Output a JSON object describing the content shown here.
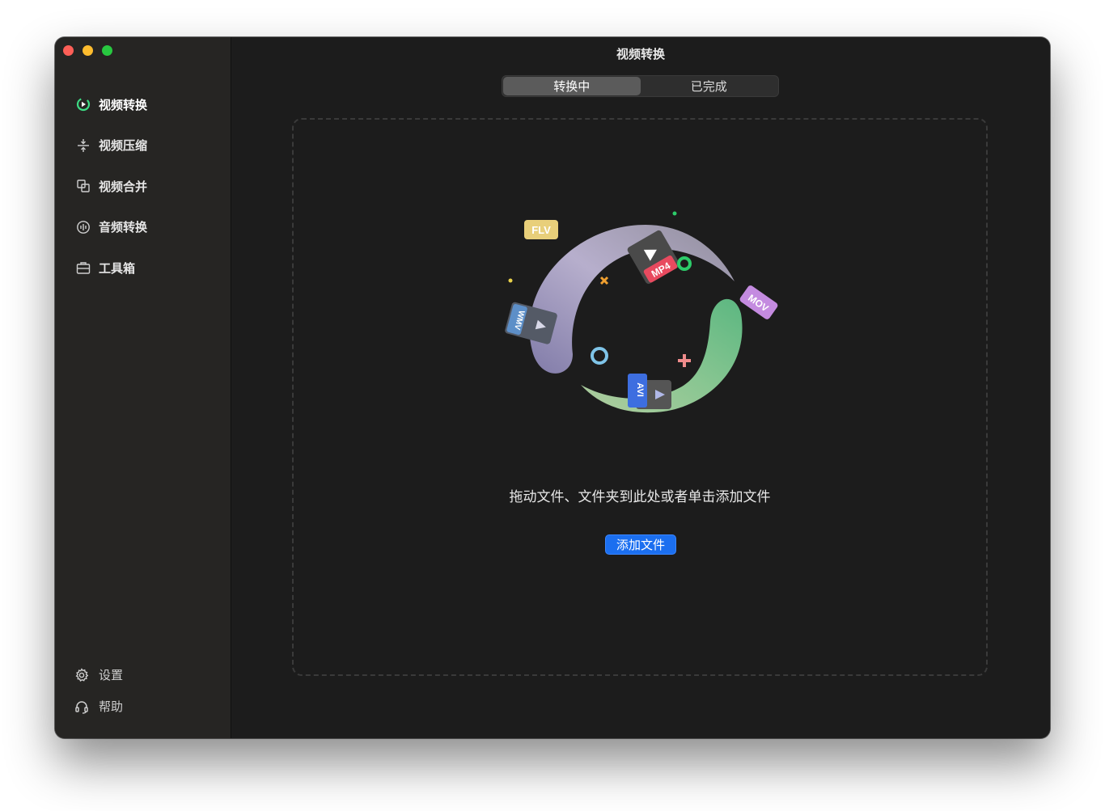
{
  "window": {
    "title": "视频转换"
  },
  "sidebar": {
    "items": [
      {
        "label": "视频转换",
        "icon": "convert-icon",
        "active": true
      },
      {
        "label": "视频压缩",
        "icon": "compress-icon",
        "active": false
      },
      {
        "label": "视频合并",
        "icon": "merge-icon",
        "active": false
      },
      {
        "label": "音频转换",
        "icon": "audio-icon",
        "active": false
      },
      {
        "label": "工具箱",
        "icon": "toolbox-icon",
        "active": false
      }
    ],
    "bottom": [
      {
        "label": "设置",
        "icon": "gear-icon"
      },
      {
        "label": "帮助",
        "icon": "headset-icon"
      }
    ]
  },
  "tabs": [
    {
      "label": "转换中",
      "active": true
    },
    {
      "label": "已完成",
      "active": false
    }
  ],
  "dropzone": {
    "hint": "拖动文件、文件夹到此处或者单击添加文件",
    "button": "添加文件",
    "formats": [
      "FLV",
      "MP4",
      "MOV",
      "WMV",
      "AVI"
    ]
  },
  "colors": {
    "accent": "#1b6ff0",
    "active_icon": "#3ddc84",
    "background": "#1c1c1c",
    "sidebar": "#262523"
  }
}
